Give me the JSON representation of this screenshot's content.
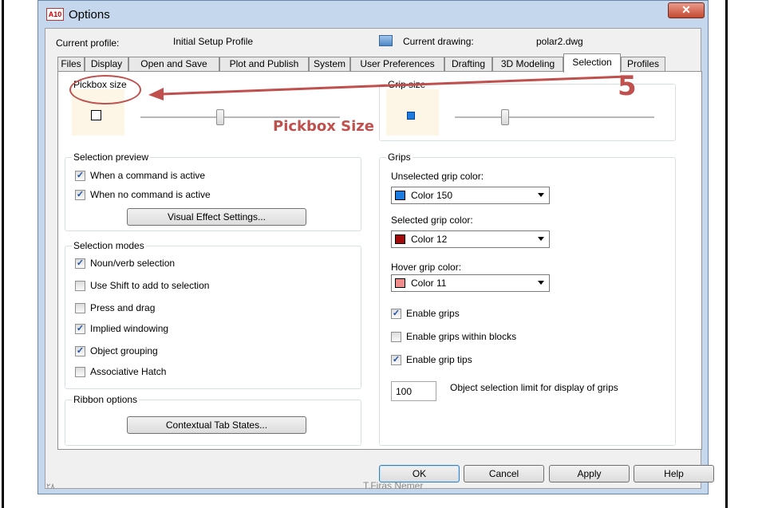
{
  "window": {
    "title": "Options",
    "app_badge": "A10",
    "close_glyph": "✕"
  },
  "profile": {
    "current_profile_label": "Current profile:",
    "current_profile_value": "Initial Setup Profile",
    "current_drawing_label": "Current drawing:",
    "current_drawing_value": "polar2.dwg"
  },
  "tabs": [
    "Files",
    "Display",
    "Open and Save",
    "Plot and Publish",
    "System",
    "User Preferences",
    "Drafting",
    "3D Modeling",
    "Selection",
    "Profiles"
  ],
  "active_tab": "Selection",
  "pickbox": {
    "title": "Pickbox size",
    "slider_level": 0.4
  },
  "grip_size": {
    "title": "Grip size",
    "slider_level": 0.25,
    "preview_color": "#1b7be0"
  },
  "selection_preview": {
    "title": "Selection preview",
    "when_active": "When a command is active",
    "when_none": "When no command is active",
    "when_active_checked": true,
    "when_none_checked": true,
    "visual_effect_button": "Visual Effect Settings..."
  },
  "selection_modes": {
    "title": "Selection modes",
    "items": [
      {
        "label": "Noun/verb selection",
        "checked": true
      },
      {
        "label": "Use Shift to add to selection",
        "checked": false
      },
      {
        "label": "Press and drag",
        "checked": false
      },
      {
        "label": "Implied windowing",
        "checked": true
      },
      {
        "label": "Object grouping",
        "checked": true
      },
      {
        "label": "Associative Hatch",
        "checked": false
      }
    ]
  },
  "ribbon": {
    "title": "Ribbon options",
    "button": "Contextual Tab States..."
  },
  "grips": {
    "title": "Grips",
    "unselected_label": "Unselected grip color:",
    "unselected_value": "Color 150",
    "unselected_color": "#1b7be0",
    "selected_label": "Selected grip color:",
    "selected_value": "Color 12",
    "selected_color": "#a50a0a",
    "hover_label": "Hover grip color:",
    "hover_value": "Color 11",
    "hover_color": "#f08c8c",
    "enable_grips": "Enable grips",
    "enable_grips_checked": true,
    "enable_in_blocks": "Enable grips within blocks",
    "enable_in_blocks_checked": false,
    "enable_tips": "Enable grip tips",
    "enable_tips_checked": true,
    "limit_value": "100",
    "limit_label": "Object selection limit for display of grips"
  },
  "buttons": {
    "ok": "OK",
    "cancel": "Cancel",
    "apply": "Apply",
    "help": "Help"
  },
  "annotations": {
    "step_number": "5",
    "pickbox_label": "Pickbox Size",
    "color": "#c0504d"
  },
  "footer": {
    "left_text": "٢٨",
    "author": "T.Firas Nemer"
  },
  "check_glyph": "✓"
}
